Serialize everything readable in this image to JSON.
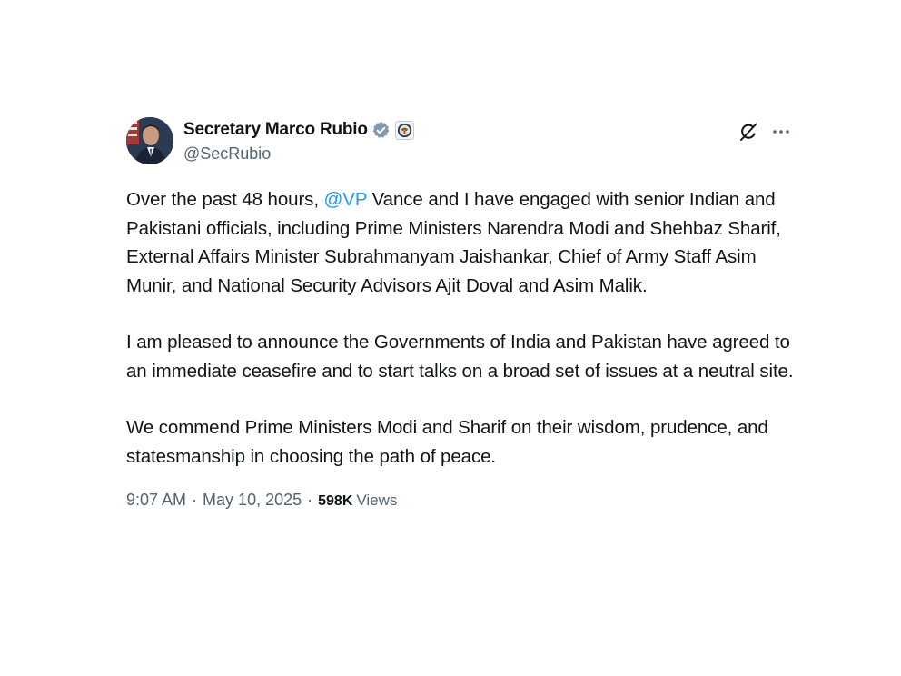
{
  "author": {
    "display_name": "Secretary Marco Rubio",
    "handle": "@SecRubio"
  },
  "tweet": {
    "paragraph1_before_mention": "Over the past 48 hours, ",
    "mention": "@VP",
    "paragraph1_after_mention": " Vance and I have engaged with senior Indian and Pakistani officials, including Prime Ministers Narendra Modi and Shehbaz Sharif, External Affairs Minister Subrahmanyam Jaishankar, Chief of Army Staff Asim Munir, and National Security Advisors Ajit Doval and Asim Malik.",
    "paragraph2": "I am pleased to announce the Governments of India and Pakistan have agreed to an immediate ceasefire and to start talks on a broad set of issues at a neutral site.",
    "paragraph3": "We commend Prime Ministers Modi and Sharif on their wisdom, prudence, and statesmanship in choosing the path of peace."
  },
  "meta": {
    "time": "9:07 AM",
    "separator": "·",
    "date": "May 10, 2025",
    "views_count": "598K",
    "views_label": "Views"
  },
  "icons": {
    "verified": "verified-badge-icon",
    "affiliation": "state-department-seal-icon",
    "grok": "grok-icon",
    "more": "more-options-icon"
  },
  "colors": {
    "link": "#1d9bf0",
    "secondary_text": "#536471",
    "primary_text": "#0f1419",
    "verified_badge": "#829aab"
  }
}
